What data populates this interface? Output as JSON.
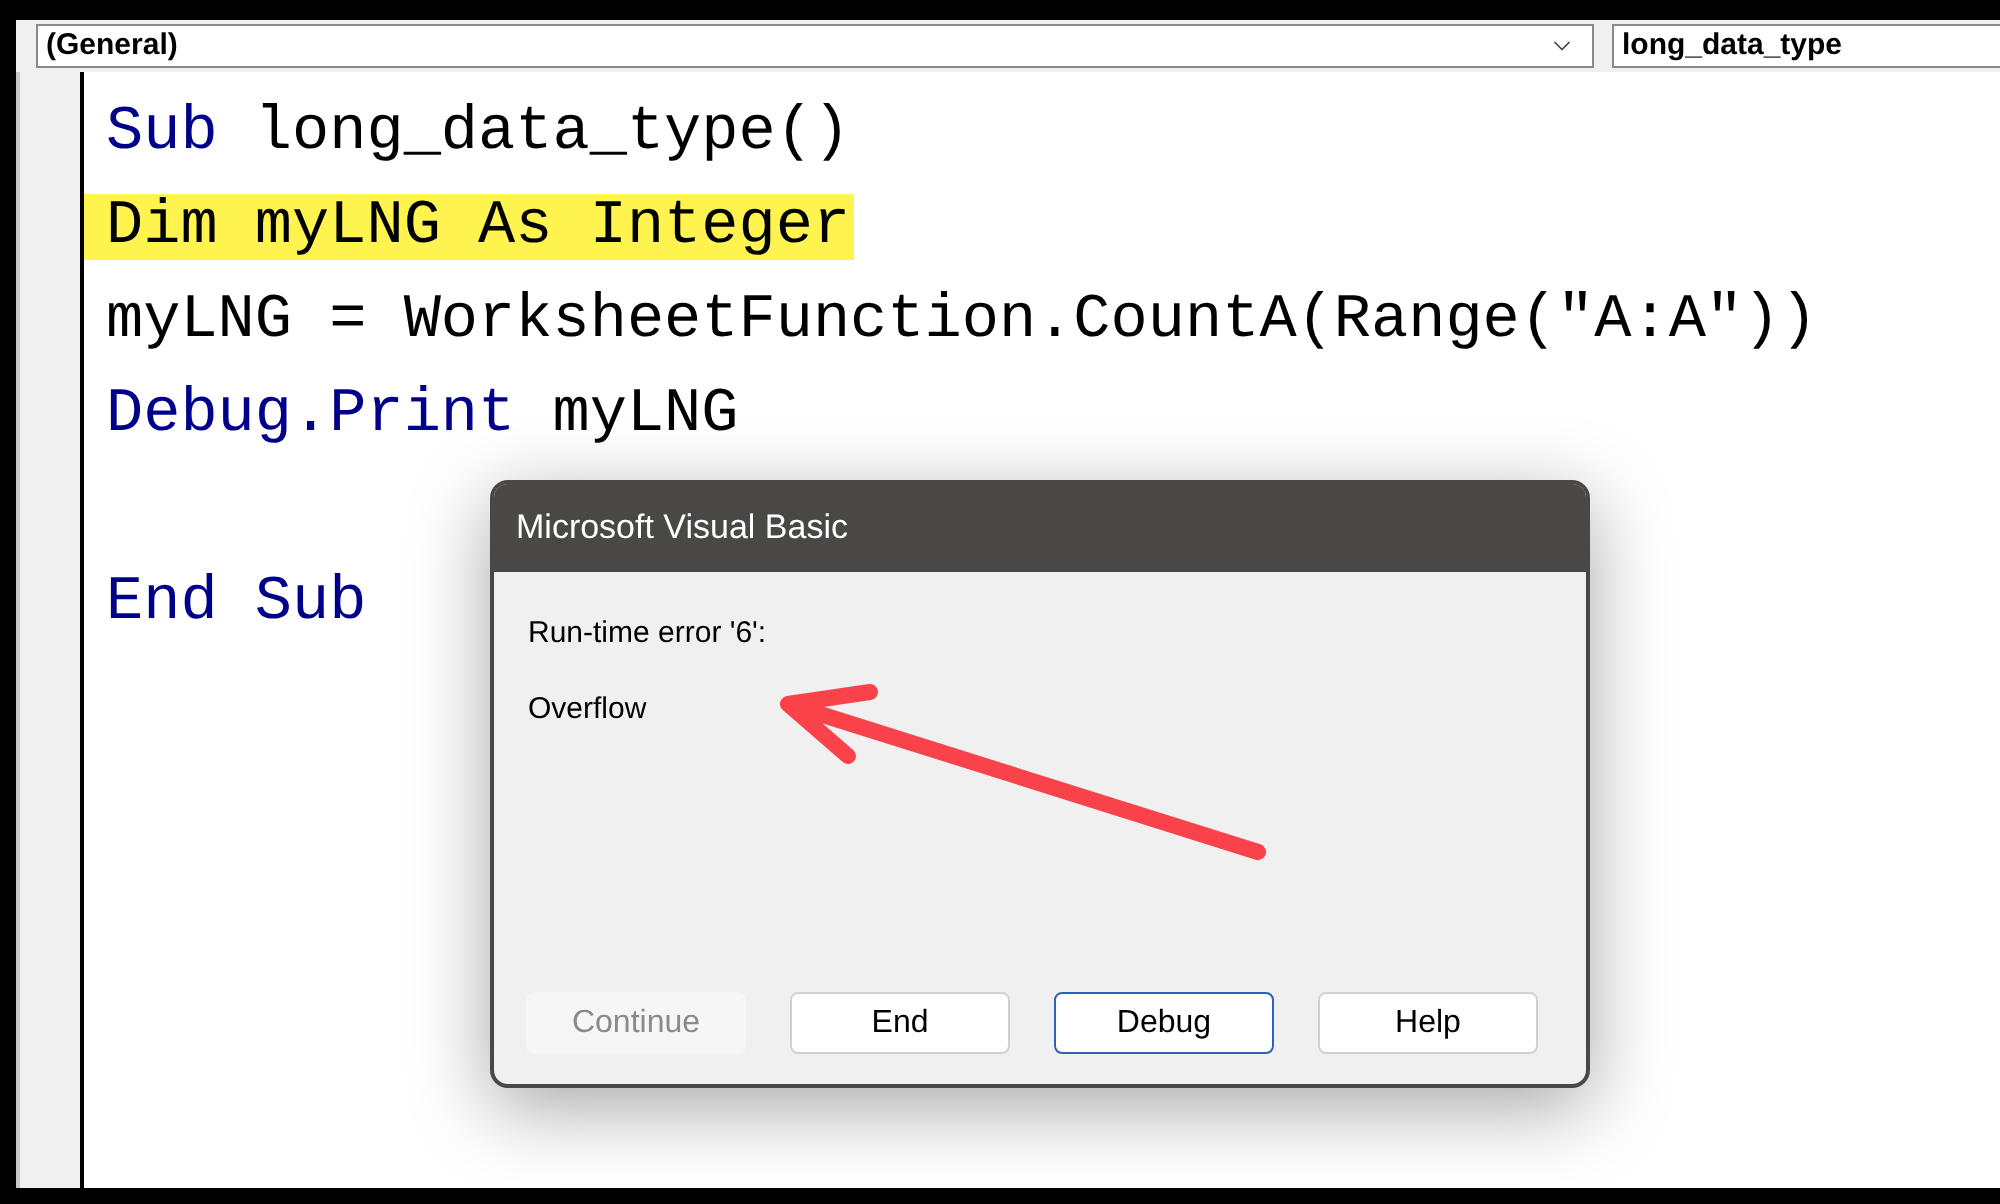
{
  "toolbar": {
    "object_box": {
      "value": "(General)"
    },
    "procedure_box": {
      "value": "long_data_type"
    }
  },
  "code": {
    "lines": [
      {
        "kind": "code",
        "highlighted": false,
        "tokens": [
          {
            "text": "Sub",
            "kind": "keyword"
          },
          {
            "text": " long_data_type()",
            "kind": "plain"
          }
        ]
      },
      {
        "kind": "code",
        "highlighted": true,
        "tokens": [
          {
            "text": "Dim myLNG As Integer",
            "kind": "plain"
          }
        ]
      },
      {
        "kind": "code",
        "highlighted": false,
        "tokens": [
          {
            "text": "myLNG = WorksheetFunction.CountA(Range(\"A:A\"))",
            "kind": "plain"
          }
        ]
      },
      {
        "kind": "code",
        "highlighted": false,
        "tokens": [
          {
            "text": "Debug.Print",
            "kind": "keyword"
          },
          {
            "text": " myLNG",
            "kind": "plain"
          }
        ]
      },
      {
        "kind": "blank"
      },
      {
        "kind": "code",
        "highlighted": false,
        "tokens": [
          {
            "text": "End Sub",
            "kind": "keyword"
          }
        ]
      }
    ]
  },
  "dialog": {
    "title": "Microsoft Visual Basic",
    "message": "Run-time error '6':",
    "detail": "Overflow",
    "buttons": [
      {
        "label": "Continue",
        "disabled": true,
        "focused": false
      },
      {
        "label": "End",
        "disabled": false,
        "focused": false
      },
      {
        "label": "Debug",
        "disabled": false,
        "focused": true
      },
      {
        "label": "Help",
        "disabled": false,
        "focused": false
      }
    ]
  }
}
